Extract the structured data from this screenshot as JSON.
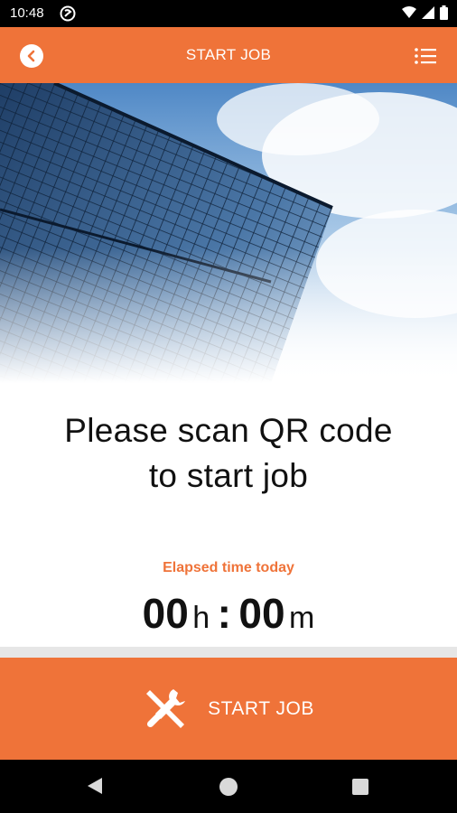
{
  "status_bar": {
    "time": "10:48",
    "left_icon": "notification-icon",
    "right_icons": [
      "wifi-icon",
      "signal-icon",
      "battery-icon"
    ]
  },
  "app_bar": {
    "title": "START JOB",
    "back_icon": "back-arrow-icon",
    "menu_icon": "list-menu-icon",
    "color": "#EF7339"
  },
  "hero": {
    "description_icon": "building-image"
  },
  "main": {
    "prompt_line1": "Please scan QR code",
    "prompt_line2": "to start job",
    "elapsed_label": "Elapsed time today",
    "hours": "00",
    "hours_unit": "h",
    "separator": ":",
    "minutes": "00",
    "minutes_unit": "m"
  },
  "start_button": {
    "label": "START JOB",
    "icon": "tools-icon"
  },
  "nav_bar": {
    "icons": [
      "nav-back-icon",
      "nav-home-icon",
      "nav-recents-icon"
    ]
  },
  "colors": {
    "accent": "#EF7339",
    "text": "#111111"
  }
}
